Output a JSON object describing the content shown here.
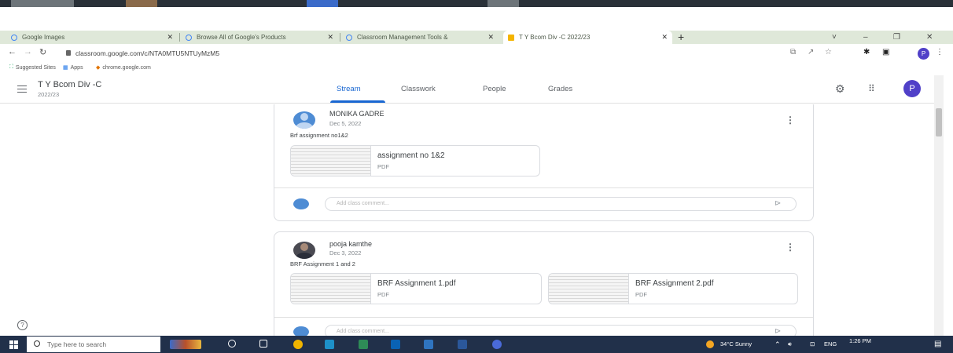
{
  "browser": {
    "tabs": [
      {
        "label": "Google Images",
        "active": false
      },
      {
        "label": "Browse All of Google's Products",
        "active": false
      },
      {
        "label": "Classroom Management Tools &",
        "active": false
      },
      {
        "label": "T Y Bcom Div -C 2022/23",
        "active": true
      }
    ],
    "new_tab": "+",
    "window_controls": {
      "chevron": "˅",
      "minimize": "–",
      "maximize": "❐",
      "close": "✕"
    },
    "url": "classroom.google.com/c/NTA0MTU5NTUyMzM5",
    "profile_initial": "P",
    "bookmarks": [
      {
        "label": "Suggested Sites"
      },
      {
        "label": "Apps"
      },
      {
        "label": "chrome.google.com"
      }
    ]
  },
  "classroom": {
    "class_title": "T Y Bcom Div -C",
    "class_subtitle": "2022/23",
    "nav_tabs": [
      "Stream",
      "Classwork",
      "People",
      "Grades"
    ],
    "active_tab": "Stream",
    "profile_initial": "P"
  },
  "posts": [
    {
      "author": "MONIKA GADRE",
      "date": "Dec 5, 2022",
      "text": "Brf assignment no1&2",
      "attachments": [
        {
          "title": "assignment no 1&2",
          "type": "PDF"
        }
      ],
      "comment_placeholder": "Add class comment..."
    },
    {
      "author": "pooja kamthe",
      "date": "Dec 3, 2022",
      "text": "BRF Assignment 1 and 2",
      "attachments": [
        {
          "title": "BRF Assignment 1.pdf",
          "type": "PDF"
        },
        {
          "title": "BRF Assignment 2.pdf",
          "type": "PDF"
        }
      ],
      "comment_placeholder": "Add class comment..."
    }
  ],
  "taskbar": {
    "search_placeholder": "Type here to search",
    "weather": "34°C  Sunny",
    "language": "ENG",
    "time": "1:26 PM"
  }
}
